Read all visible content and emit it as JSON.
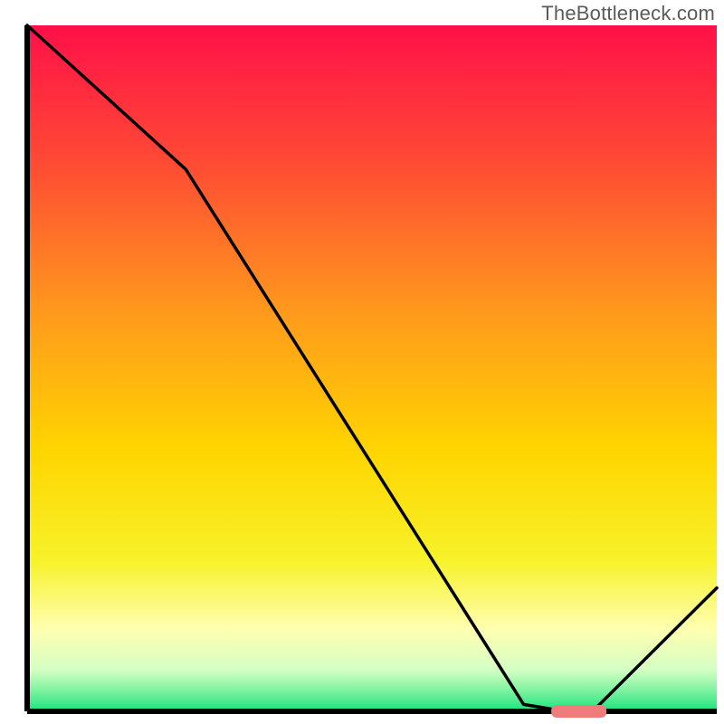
{
  "attribution": "TheBottleneck.com",
  "chart_data": {
    "type": "line",
    "title": "",
    "xlabel": "",
    "ylabel": "",
    "xlim": [
      0,
      100
    ],
    "ylim": [
      0,
      100
    ],
    "x": [
      0,
      23,
      72,
      78,
      82,
      100
    ],
    "values": [
      100,
      79,
      1,
      0,
      0,
      18
    ],
    "marker": {
      "x_start": 76,
      "x_end": 84,
      "y": 0
    },
    "gradient_stops": [
      {
        "offset": 0.0,
        "color": "#ff1048"
      },
      {
        "offset": 0.2,
        "color": "#ff4a34"
      },
      {
        "offset": 0.42,
        "color": "#ff9a1c"
      },
      {
        "offset": 0.62,
        "color": "#ffd500"
      },
      {
        "offset": 0.78,
        "color": "#f7f22a"
      },
      {
        "offset": 0.88,
        "color": "#ffffb0"
      },
      {
        "offset": 0.94,
        "color": "#d4ffc4"
      },
      {
        "offset": 0.97,
        "color": "#7ef2a0"
      },
      {
        "offset": 1.0,
        "color": "#18e47a"
      }
    ],
    "axis_color": "#000000",
    "line_color": "#000000",
    "marker_color": "#ef7b7b"
  }
}
